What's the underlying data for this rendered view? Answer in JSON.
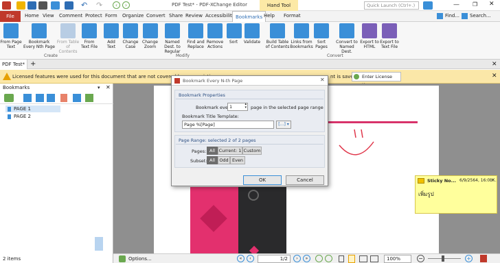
{
  "app": {
    "title": "PDF Test* - PDF-XChange Editor",
    "context_tab": "Hand Tool",
    "quick_launch_placeholder": "Quick Launch (Ctrl+.)"
  },
  "menu": {
    "file": "File",
    "items": [
      "Home",
      "View",
      "Comment",
      "Protect",
      "Form",
      "Organize",
      "Convert",
      "Share",
      "Review",
      "Accessibility",
      "Bookmarks",
      "Help",
      "Format"
    ],
    "find": "Find...",
    "search": "Search..."
  },
  "ribbon": {
    "buttons": [
      {
        "label": "From Page Text",
        "disabled": false
      },
      {
        "label": "Bookmark Every Nth Page",
        "disabled": false
      },
      {
        "label": "From Table of Contents",
        "disabled": true
      },
      {
        "label": "From Text File",
        "disabled": false
      },
      {
        "label": "Add Text",
        "disabled": false
      },
      {
        "label": "Change Case",
        "disabled": false
      },
      {
        "label": "Change Zoom",
        "disabled": false
      },
      {
        "label": "Named Dest. to Regular",
        "disabled": false
      },
      {
        "label": "Find and Replace",
        "disabled": false
      },
      {
        "label": "Remove Actions",
        "disabled": false
      },
      {
        "label": "Sort",
        "disabled": false
      },
      {
        "label": "Validate",
        "disabled": false
      },
      {
        "label": "Build Table of Contents",
        "disabled": false
      },
      {
        "label": "Links from Bookmarks",
        "disabled": false
      },
      {
        "label": "Sort Pages",
        "disabled": false
      },
      {
        "label": "Convert to Named Dest.",
        "disabled": false
      },
      {
        "label": "Export to HTML",
        "disabled": false
      },
      {
        "label": "Export to Text File",
        "disabled": false
      }
    ],
    "groups": {
      "create": "Create",
      "modify": "Modify",
      "convert": "Convert"
    }
  },
  "tab": {
    "label": "PDF Test*",
    "add": "+"
  },
  "warning": {
    "left": "Licensed features were used for this document that are not covered by your existi",
    "right": "nt is saved.",
    "button": "Enter License Key..."
  },
  "bookmarks_panel": {
    "title": "Bookmarks",
    "items": [
      "PAGE 1",
      "PAGE 2"
    ],
    "count": "2 items"
  },
  "dialog": {
    "title": "Bookmark Every N-th Page",
    "section1": "Bookmark Properties",
    "every_label": "Bookmark every",
    "every_value": "1",
    "every_suffix": "page in the selected page range",
    "template_label": "Bookmark Title Template:",
    "template_value": "Page %[Page]",
    "section2": "Page Range: selected 2 of 2 pages",
    "pages_label": "Pages:",
    "pages_options": [
      "All",
      "Current: 1",
      "Custom"
    ],
    "subset_label": "Subset:",
    "subset_options": [
      "All",
      "Odd",
      "Even"
    ],
    "ok": "OK",
    "cancel": "Cancel"
  },
  "sticky": {
    "title": "Sticky No...",
    "date": "6/9/2564, 16:0b...",
    "text": "เพิ่มรูป"
  },
  "statusbar": {
    "options": "Options...",
    "page_value": "1/2",
    "zoom": "100%"
  }
}
